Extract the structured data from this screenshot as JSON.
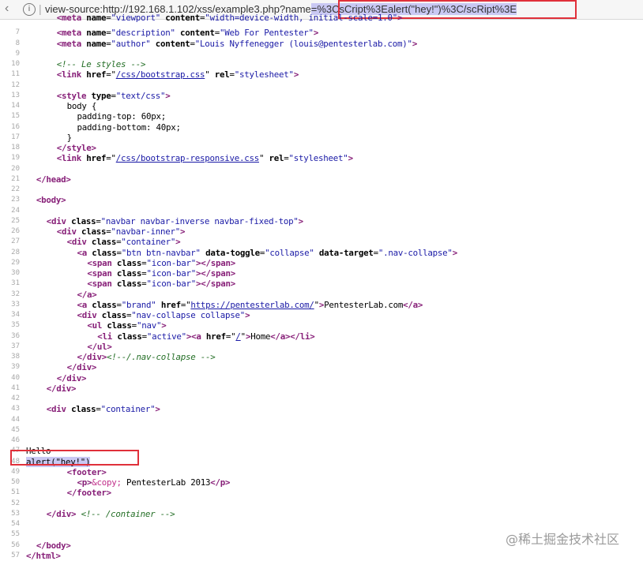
{
  "address_bar": {
    "prefix": "view-source:http://192.168.1.102/xss/example3.php?name",
    "highlighted": "=%3CsCript%3Ealert(\"hey!\")%3C/scRipt%3E"
  },
  "source": [
    {
      "n": "",
      "segs": [
        {
          "c": "t",
          "t": "<meta "
        },
        {
          "c": "a",
          "t": "name"
        },
        {
          "t": "="
        },
        {
          "c": "v",
          "t": "\"viewport\""
        },
        {
          "t": " "
        },
        {
          "c": "a",
          "t": "content"
        },
        {
          "t": "="
        },
        {
          "c": "v",
          "t": "\"width=device-width, initial-scale=1.0\""
        },
        {
          "c": "t",
          "t": ">"
        }
      ],
      "indent": 6,
      "cut": true
    },
    {
      "n": "7",
      "indent": 6,
      "segs": [
        {
          "c": "t",
          "t": "<meta "
        },
        {
          "c": "a",
          "t": "name"
        },
        {
          "t": "="
        },
        {
          "c": "v",
          "t": "\"description\""
        },
        {
          "t": " "
        },
        {
          "c": "a",
          "t": "content"
        },
        {
          "t": "="
        },
        {
          "c": "v",
          "t": "\"Web For Pentester\""
        },
        {
          "c": "t",
          "t": ">"
        }
      ]
    },
    {
      "n": "8",
      "indent": 6,
      "segs": [
        {
          "c": "t",
          "t": "<meta "
        },
        {
          "c": "a",
          "t": "name"
        },
        {
          "t": "="
        },
        {
          "c": "v",
          "t": "\"author\""
        },
        {
          "t": " "
        },
        {
          "c": "a",
          "t": "content"
        },
        {
          "t": "="
        },
        {
          "c": "v",
          "t": "\"Louis Nyffenegger (louis@pentesterlab.com)\""
        },
        {
          "c": "t",
          "t": ">"
        }
      ]
    },
    {
      "n": "9",
      "segs": []
    },
    {
      "n": "10",
      "indent": 6,
      "segs": [
        {
          "c": "c",
          "t": "<!-- Le styles -->"
        }
      ]
    },
    {
      "n": "11",
      "indent": 6,
      "segs": [
        {
          "c": "t",
          "t": "<link "
        },
        {
          "c": "a",
          "t": "href"
        },
        {
          "t": "=\""
        },
        {
          "c": "l",
          "t": "/css/bootstrap.css"
        },
        {
          "t": "\" "
        },
        {
          "c": "a",
          "t": "rel"
        },
        {
          "t": "="
        },
        {
          "c": "v",
          "t": "\"stylesheet\""
        },
        {
          "c": "t",
          "t": ">"
        }
      ]
    },
    {
      "n": "12",
      "segs": []
    },
    {
      "n": "13",
      "indent": 6,
      "segs": [
        {
          "c": "t",
          "t": "<style "
        },
        {
          "c": "a",
          "t": "type"
        },
        {
          "t": "="
        },
        {
          "c": "v",
          "t": "\"text/css\""
        },
        {
          "c": "t",
          "t": ">"
        }
      ]
    },
    {
      "n": "14",
      "indent": 8,
      "segs": [
        {
          "t": "body {"
        }
      ]
    },
    {
      "n": "15",
      "indent": 10,
      "segs": [
        {
          "t": "padding-top: 60px;"
        }
      ]
    },
    {
      "n": "16",
      "indent": 10,
      "segs": [
        {
          "t": "padding-bottom: 40px;"
        }
      ]
    },
    {
      "n": "17",
      "indent": 8,
      "segs": [
        {
          "t": "}"
        }
      ]
    },
    {
      "n": "18",
      "indent": 6,
      "segs": [
        {
          "c": "t",
          "t": "</style>"
        }
      ]
    },
    {
      "n": "19",
      "indent": 6,
      "segs": [
        {
          "c": "t",
          "t": "<link "
        },
        {
          "c": "a",
          "t": "href"
        },
        {
          "t": "=\""
        },
        {
          "c": "l",
          "t": "/css/bootstrap-responsive.css"
        },
        {
          "t": "\" "
        },
        {
          "c": "a",
          "t": "rel"
        },
        {
          "t": "="
        },
        {
          "c": "v",
          "t": "\"stylesheet\""
        },
        {
          "c": "t",
          "t": ">"
        }
      ]
    },
    {
      "n": "20",
      "segs": []
    },
    {
      "n": "21",
      "indent": 2,
      "segs": [
        {
          "c": "t",
          "t": "</head>"
        }
      ]
    },
    {
      "n": "22",
      "segs": []
    },
    {
      "n": "23",
      "indent": 2,
      "segs": [
        {
          "c": "t",
          "t": "<body>"
        }
      ]
    },
    {
      "n": "24",
      "segs": []
    },
    {
      "n": "25",
      "indent": 4,
      "segs": [
        {
          "c": "t",
          "t": "<div "
        },
        {
          "c": "a",
          "t": "class"
        },
        {
          "t": "="
        },
        {
          "c": "v",
          "t": "\"navbar navbar-inverse navbar-fixed-top\""
        },
        {
          "c": "t",
          "t": ">"
        }
      ]
    },
    {
      "n": "26",
      "indent": 6,
      "segs": [
        {
          "c": "t",
          "t": "<div "
        },
        {
          "c": "a",
          "t": "class"
        },
        {
          "t": "="
        },
        {
          "c": "v",
          "t": "\"navbar-inner\""
        },
        {
          "c": "t",
          "t": ">"
        }
      ]
    },
    {
      "n": "27",
      "indent": 8,
      "segs": [
        {
          "c": "t",
          "t": "<div "
        },
        {
          "c": "a",
          "t": "class"
        },
        {
          "t": "="
        },
        {
          "c": "v",
          "t": "\"container\""
        },
        {
          "c": "t",
          "t": ">"
        }
      ]
    },
    {
      "n": "28",
      "indent": 10,
      "segs": [
        {
          "c": "t",
          "t": "<a "
        },
        {
          "c": "a",
          "t": "class"
        },
        {
          "t": "="
        },
        {
          "c": "v",
          "t": "\"btn btn-navbar\""
        },
        {
          "t": " "
        },
        {
          "c": "a",
          "t": "data-toggle"
        },
        {
          "t": "="
        },
        {
          "c": "v",
          "t": "\"collapse\""
        },
        {
          "t": " "
        },
        {
          "c": "a",
          "t": "data-target"
        },
        {
          "t": "="
        },
        {
          "c": "v",
          "t": "\".nav-collapse\""
        },
        {
          "c": "t",
          "t": ">"
        }
      ]
    },
    {
      "n": "29",
      "indent": 12,
      "segs": [
        {
          "c": "t",
          "t": "<span "
        },
        {
          "c": "a",
          "t": "class"
        },
        {
          "t": "="
        },
        {
          "c": "v",
          "t": "\"icon-bar\""
        },
        {
          "c": "t",
          "t": "></span>"
        }
      ]
    },
    {
      "n": "30",
      "indent": 12,
      "segs": [
        {
          "c": "t",
          "t": "<span "
        },
        {
          "c": "a",
          "t": "class"
        },
        {
          "t": "="
        },
        {
          "c": "v",
          "t": "\"icon-bar\""
        },
        {
          "c": "t",
          "t": "></span>"
        }
      ]
    },
    {
      "n": "31",
      "indent": 12,
      "segs": [
        {
          "c": "t",
          "t": "<span "
        },
        {
          "c": "a",
          "t": "class"
        },
        {
          "t": "="
        },
        {
          "c": "v",
          "t": "\"icon-bar\""
        },
        {
          "c": "t",
          "t": "></span>"
        }
      ]
    },
    {
      "n": "32",
      "indent": 10,
      "segs": [
        {
          "c": "t",
          "t": "</a>"
        }
      ]
    },
    {
      "n": "33",
      "indent": 10,
      "segs": [
        {
          "c": "t",
          "t": "<a "
        },
        {
          "c": "a",
          "t": "class"
        },
        {
          "t": "="
        },
        {
          "c": "v",
          "t": "\"brand\""
        },
        {
          "t": " "
        },
        {
          "c": "a",
          "t": "href"
        },
        {
          "t": "=\""
        },
        {
          "c": "l",
          "t": "https://pentesterlab.com/"
        },
        {
          "t": "\""
        },
        {
          "c": "t",
          "t": ">"
        },
        {
          "t": "PentesterLab.com"
        },
        {
          "c": "t",
          "t": "</a>"
        }
      ]
    },
    {
      "n": "34",
      "indent": 10,
      "segs": [
        {
          "c": "t",
          "t": "<div "
        },
        {
          "c": "a",
          "t": "class"
        },
        {
          "t": "="
        },
        {
          "c": "v",
          "t": "\"nav-collapse collapse\""
        },
        {
          "c": "t",
          "t": ">"
        }
      ]
    },
    {
      "n": "35",
      "indent": 12,
      "segs": [
        {
          "c": "t",
          "t": "<ul "
        },
        {
          "c": "a",
          "t": "class"
        },
        {
          "t": "="
        },
        {
          "c": "v",
          "t": "\"nav\""
        },
        {
          "c": "t",
          "t": ">"
        }
      ]
    },
    {
      "n": "36",
      "indent": 14,
      "segs": [
        {
          "c": "t",
          "t": "<li "
        },
        {
          "c": "a",
          "t": "class"
        },
        {
          "t": "="
        },
        {
          "c": "v",
          "t": "\"active\""
        },
        {
          "c": "t",
          "t": "><a "
        },
        {
          "c": "a",
          "t": "href"
        },
        {
          "t": "=\""
        },
        {
          "c": "l",
          "t": "/"
        },
        {
          "t": "\""
        },
        {
          "c": "t",
          "t": ">"
        },
        {
          "t": "Home"
        },
        {
          "c": "t",
          "t": "</a></li>"
        }
      ]
    },
    {
      "n": "37",
      "indent": 12,
      "segs": [
        {
          "c": "t",
          "t": "</ul>"
        }
      ]
    },
    {
      "n": "38",
      "indent": 10,
      "segs": [
        {
          "c": "t",
          "t": "</div>"
        },
        {
          "c": "c",
          "t": "<!--/.nav-collapse -->"
        }
      ]
    },
    {
      "n": "39",
      "indent": 8,
      "segs": [
        {
          "c": "t",
          "t": "</div>"
        }
      ]
    },
    {
      "n": "40",
      "indent": 6,
      "segs": [
        {
          "c": "t",
          "t": "</div>"
        }
      ]
    },
    {
      "n": "41",
      "indent": 4,
      "segs": [
        {
          "c": "t",
          "t": "</div>"
        }
      ]
    },
    {
      "n": "42",
      "segs": []
    },
    {
      "n": "43",
      "indent": 4,
      "segs": [
        {
          "c": "t",
          "t": "<div "
        },
        {
          "c": "a",
          "t": "class"
        },
        {
          "t": "="
        },
        {
          "c": "v",
          "t": "\"container\""
        },
        {
          "c": "t",
          "t": ">"
        }
      ]
    },
    {
      "n": "44",
      "segs": []
    },
    {
      "n": "45",
      "segs": []
    },
    {
      "n": "46",
      "segs": []
    },
    {
      "n": "47",
      "indent": 0,
      "segs": [
        {
          "t": "Hello"
        }
      ]
    },
    {
      "n": "48",
      "indent": 0,
      "hl": true,
      "segs": [
        {
          "t": "alert(\"hey!\")"
        }
      ]
    },
    {
      "n": "49",
      "indent": 8,
      "segs": [
        {
          "c": "t",
          "t": "<footer>"
        }
      ]
    },
    {
      "n": "50",
      "indent": 10,
      "segs": [
        {
          "c": "t",
          "t": "<p>"
        },
        {
          "c": "e",
          "t": "&copy;"
        },
        {
          "t": " PentesterLab 2013"
        },
        {
          "c": "t",
          "t": "</p>"
        }
      ]
    },
    {
      "n": "51",
      "indent": 8,
      "segs": [
        {
          "c": "t",
          "t": "</footer>"
        }
      ]
    },
    {
      "n": "52",
      "segs": []
    },
    {
      "n": "53",
      "indent": 4,
      "segs": [
        {
          "c": "t",
          "t": "</div>"
        },
        {
          "t": " "
        },
        {
          "c": "c",
          "t": "<!-- /container -->"
        }
      ]
    },
    {
      "n": "54",
      "segs": []
    },
    {
      "n": "55",
      "segs": []
    },
    {
      "n": "56",
      "indent": 2,
      "segs": [
        {
          "c": "t",
          "t": "</body>"
        }
      ]
    },
    {
      "n": "57",
      "indent": 0,
      "segs": [
        {
          "c": "t",
          "t": "</html>"
        }
      ]
    }
  ],
  "watermark": "@稀土掘金技术社区"
}
